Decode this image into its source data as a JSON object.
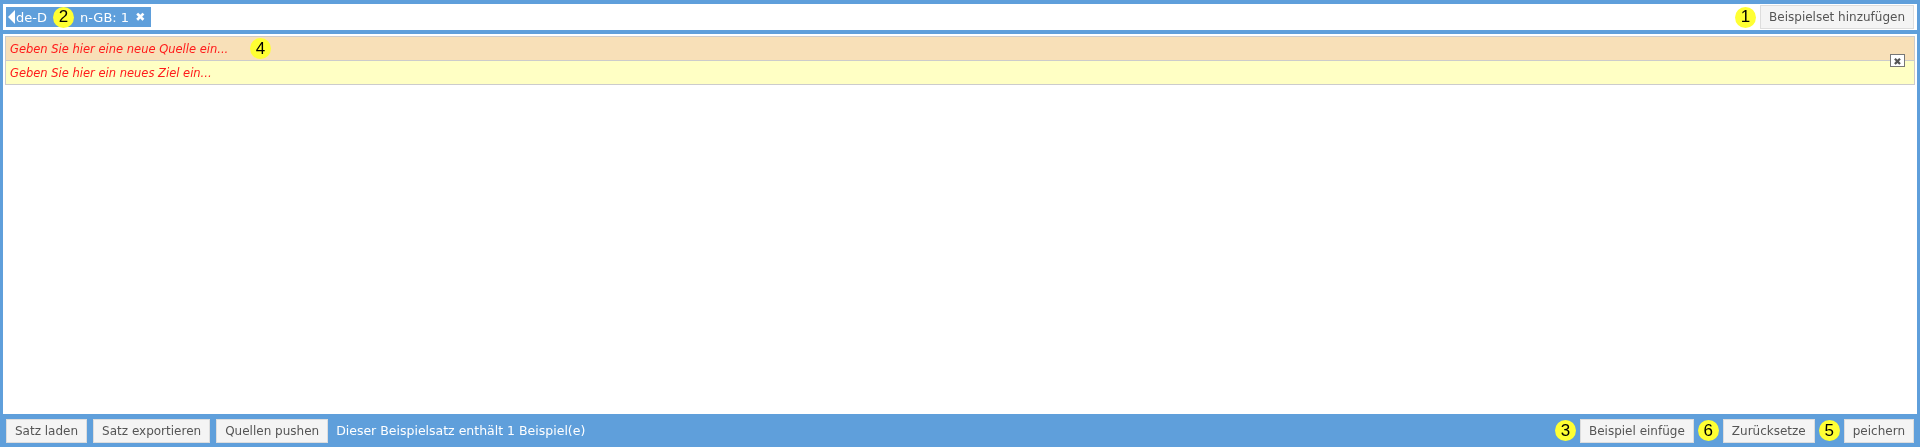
{
  "top_bar": {
    "tag": {
      "text_parts": [
        "de-D",
        "n-GB: 1"
      ],
      "callout": "2",
      "close": "✖"
    },
    "add_button": {
      "label": "Beispielset hinzufügen",
      "callout": "1"
    }
  },
  "editor": {
    "source": {
      "placeholder": "Geben Sie hier eine neue Quelle ein...",
      "callout": "4"
    },
    "target": {
      "placeholder": "Geben Sie hier ein neues Ziel ein..."
    },
    "remove": "✖"
  },
  "bottom_bar": {
    "left_buttons": [
      {
        "label": "Satz laden"
      },
      {
        "label": "Satz exportieren"
      },
      {
        "label": "Quellen pushen"
      }
    ],
    "status": "Dieser Beispielsatz enthält 1 Beispiel(e)",
    "right_buttons": [
      {
        "label": "Beispiel einfüge",
        "callout": "3"
      },
      {
        "label": "Zurücksetze",
        "callout": "6"
      },
      {
        "label": "peichern",
        "callout": "5"
      }
    ]
  }
}
